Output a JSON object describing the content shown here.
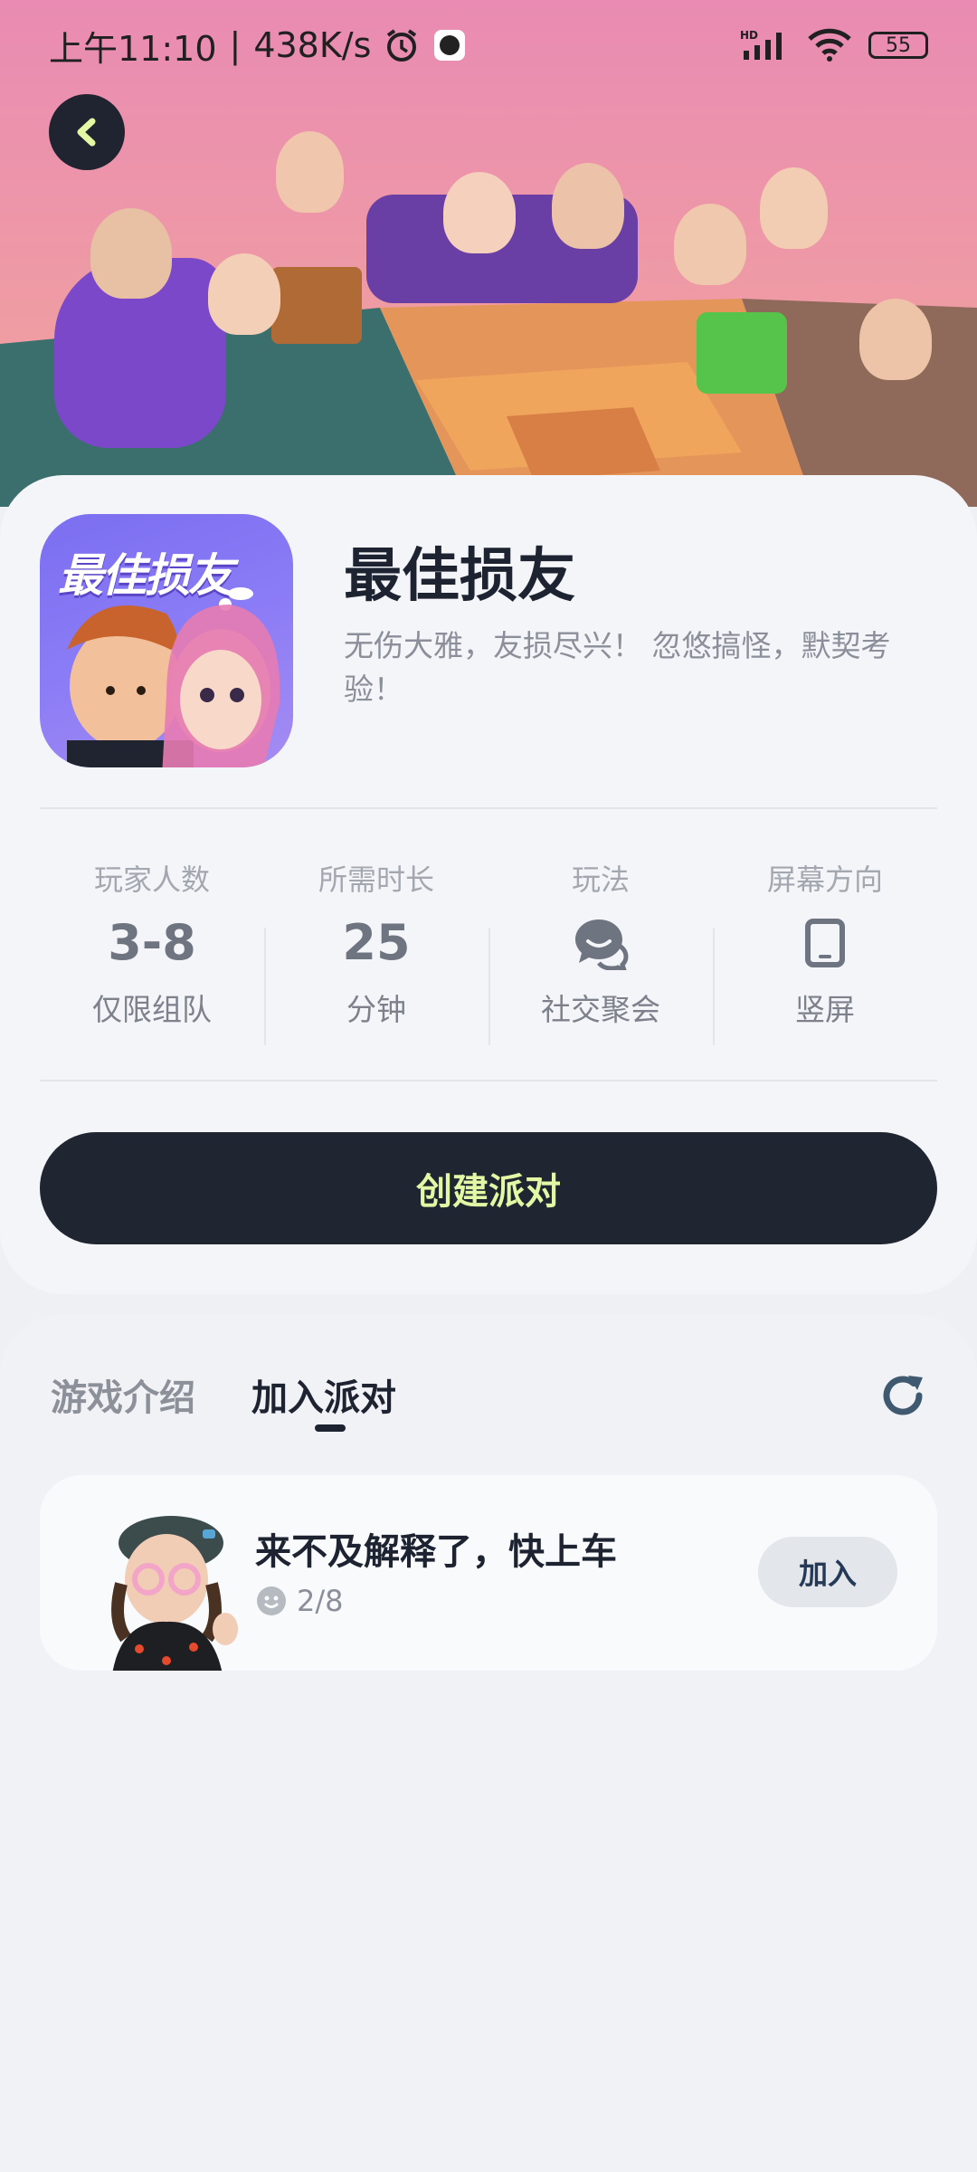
{
  "status_bar": {
    "time": "上午11:10",
    "separator": "|",
    "speed": "438K/s",
    "network": "HD",
    "battery": "55"
  },
  "game": {
    "icon_title": "最佳损友",
    "title": "最佳损友",
    "description": "无伤大雅，友损尽兴！ 忽悠搞怪，默契考验！"
  },
  "stats": [
    {
      "label": "玩家人数",
      "value": "3-8",
      "sub": "仅限组队"
    },
    {
      "label": "所需时长",
      "value": "25",
      "sub": "分钟"
    },
    {
      "label": "玩法",
      "icon": "chat-bubble-icon",
      "sub": "社交聚会"
    },
    {
      "label": "屏幕方向",
      "icon": "phone-portrait-icon",
      "sub": "竖屏"
    }
  ],
  "create_button": "创建派对",
  "tabs": {
    "intro": "游戏介绍",
    "join": "加入派对"
  },
  "party": {
    "name": "来不及解释了，快上车",
    "count": "2/8",
    "join_label": "加入"
  },
  "colors": {
    "dark": "#1f2631",
    "accent_text": "#e3f7a4",
    "hero_pink": "#e98bb3"
  }
}
